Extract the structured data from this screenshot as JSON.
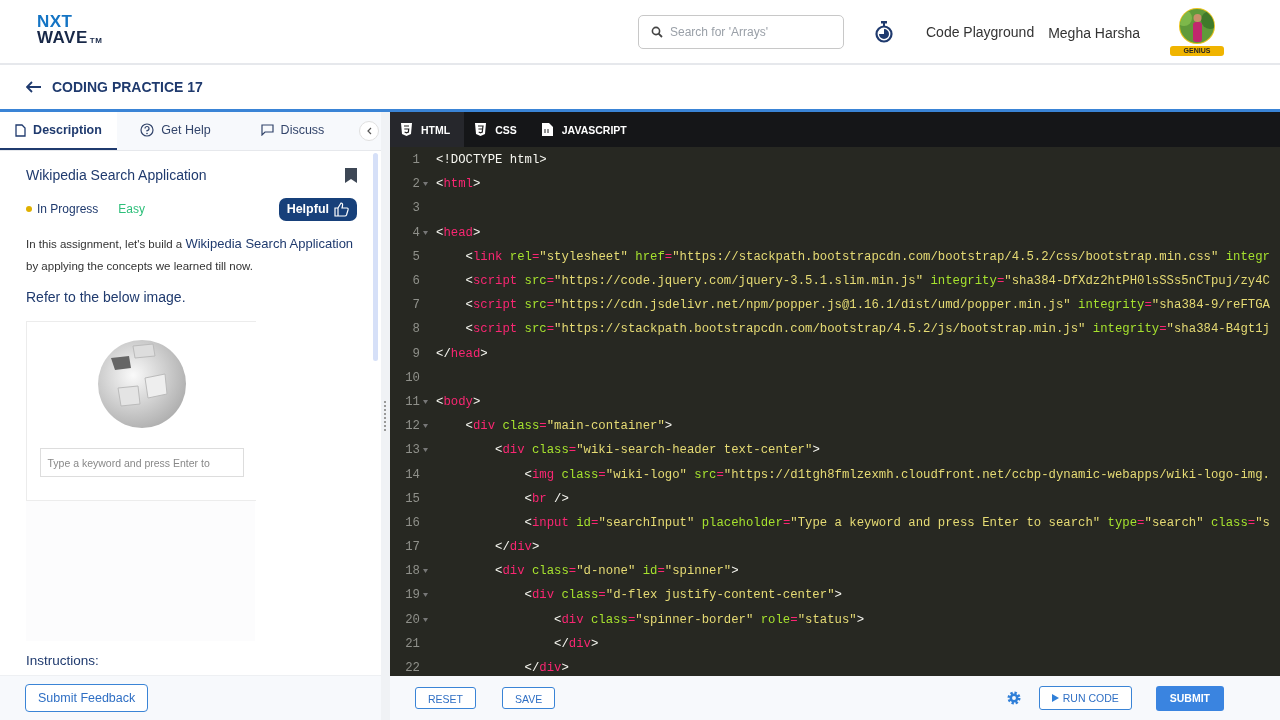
{
  "header": {
    "logo_top": "NXT",
    "logo_bottom": "WAVE",
    "logo_tm": "TM",
    "search": {
      "placeholder": "Search for 'Arrays'"
    },
    "links": [
      "Code Playground"
    ],
    "user": "Megha Harsha",
    "badge": "GENIUS"
  },
  "breadcrumb": {
    "title": "CODING PRACTICE 17"
  },
  "left_tabs": [
    {
      "label": "Description",
      "selected": true
    },
    {
      "label": "Get Help",
      "selected": false
    },
    {
      "label": "Discuss",
      "selected": false
    }
  ],
  "problem": {
    "title": "Wikipedia Search Application",
    "bookmarked": true,
    "status": "In Progress",
    "difficulty": "Easy",
    "helpful": "Helpful",
    "intro": "In this assignment, let's build a **Wikipedia Search Application** by applying the concepts we learned till now.",
    "refer": "Refer to the below image.",
    "preview_placeholder": "Type a keyword and press Enter to",
    "instructions": "Instructions:"
  },
  "submit_feedback": "Submit Feedback",
  "editor_tabs": [
    {
      "label": "HTML",
      "selected": true
    },
    {
      "label": "CSS",
      "selected": false
    },
    {
      "label": "JAVASCRIPT",
      "selected": false
    }
  ],
  "code_lines": [
    {
      "number": "1",
      "foldable": false,
      "tokens": [
        {
          "kind": "text",
          "text": "<!DOCTYPE html>"
        }
      ]
    },
    {
      "number": "2",
      "foldable": true,
      "tokens": [
        {
          "kind": "punct",
          "text": "<"
        },
        {
          "kind": "tag",
          "text": "html"
        },
        {
          "kind": "punct",
          "text": ">"
        }
      ]
    },
    {
      "number": "3",
      "foldable": false
    },
    {
      "number": "4",
      "foldable": true,
      "tokens": [
        {
          "kind": "punct",
          "text": "<"
        },
        {
          "kind": "tag",
          "text": "head"
        },
        {
          "kind": "punct",
          "text": ">"
        }
      ]
    },
    {
      "number": "5",
      "foldable": false,
      "tokens": [
        {
          "kind": "text",
          "text": "    <"
        },
        {
          "kind": "tag",
          "text": "link"
        },
        {
          "kind": "attr",
          "text": " rel"
        },
        {
          "kind": "tag",
          "text": "="
        },
        {
          "kind": "str",
          "text": "\"stylesheet\""
        },
        {
          "kind": "attr",
          "text": " href"
        },
        {
          "kind": "tag",
          "text": "="
        },
        {
          "kind": "str",
          "text": "\"https://stackpath.bootstrapcdn.com/bootstrap/4.5.2/css/bootstrap.min.css\""
        },
        {
          "kind": "attr",
          "text": " integr"
        }
      ]
    },
    {
      "number": "6",
      "foldable": false,
      "tokens": [
        {
          "kind": "text",
          "text": "    <"
        },
        {
          "kind": "tag",
          "text": "script"
        },
        {
          "kind": "attr",
          "text": " src"
        },
        {
          "kind": "tag",
          "text": "="
        },
        {
          "kind": "str",
          "text": "\"https://code.jquery.com/jquery-3.5.1.slim.min.js\""
        },
        {
          "kind": "attr",
          "text": " integrity"
        },
        {
          "kind": "tag",
          "text": "="
        },
        {
          "kind": "str",
          "text": "\"sha384-DfXdz2htPH0lsSSs5nCTpuj/zy4C"
        }
      ]
    },
    {
      "number": "7",
      "foldable": false,
      "tokens": [
        {
          "kind": "text",
          "text": "    <"
        },
        {
          "kind": "tag",
          "text": "script"
        },
        {
          "kind": "attr",
          "text": " src"
        },
        {
          "kind": "tag",
          "text": "="
        },
        {
          "kind": "str",
          "text": "\"https://cdn.jsdelivr.net/npm/popper.js@1.16.1/dist/umd/popper.min.js\""
        },
        {
          "kind": "attr",
          "text": " integrity"
        },
        {
          "kind": "tag",
          "text": "="
        },
        {
          "kind": "str",
          "text": "\"sha384-9/reFTGA"
        }
      ]
    },
    {
      "number": "8",
      "foldable": false,
      "tokens": [
        {
          "kind": "text",
          "text": "    <"
        },
        {
          "kind": "tag",
          "text": "script"
        },
        {
          "kind": "attr",
          "text": " src"
        },
        {
          "kind": "tag",
          "text": "="
        },
        {
          "kind": "str",
          "text": "\"https://stackpath.bootstrapcdn.com/bootstrap/4.5.2/js/bootstrap.min.js\""
        },
        {
          "kind": "attr",
          "text": " integrity"
        },
        {
          "kind": "tag",
          "text": "="
        },
        {
          "kind": "str",
          "text": "\"sha384-B4gt1j"
        }
      ]
    },
    {
      "number": "9",
      "foldable": false,
      "tokens": [
        {
          "kind": "punct",
          "text": "</"
        },
        {
          "kind": "tag",
          "text": "head"
        },
        {
          "kind": "punct",
          "text": ">"
        }
      ]
    },
    {
      "number": "10",
      "foldable": false
    },
    {
      "number": "11",
      "foldable": true,
      "tokens": [
        {
          "kind": "punct",
          "text": "<"
        },
        {
          "kind": "tag",
          "text": "body"
        },
        {
          "kind": "punct",
          "text": ">"
        }
      ]
    },
    {
      "number": "12",
      "foldable": true,
      "tokens": [
        {
          "kind": "text",
          "text": "    <"
        },
        {
          "kind": "tag",
          "text": "div"
        },
        {
          "kind": "attr",
          "text": " class"
        },
        {
          "kind": "tag",
          "text": "="
        },
        {
          "kind": "str",
          "text": "\"main-container\""
        },
        {
          "kind": "punct",
          "text": ">"
        }
      ]
    },
    {
      "number": "13",
      "foldable": true,
      "tokens": [
        {
          "kind": "text",
          "text": "        <"
        },
        {
          "kind": "tag",
          "text": "div"
        },
        {
          "kind": "attr",
          "text": " class"
        },
        {
          "kind": "tag",
          "text": "="
        },
        {
          "kind": "str",
          "text": "\"wiki-search-header text-center\""
        },
        {
          "kind": "punct",
          "text": ">"
        }
      ]
    },
    {
      "number": "14",
      "foldable": false,
      "tokens": [
        {
          "kind": "text",
          "text": "            <"
        },
        {
          "kind": "tag",
          "text": "img"
        },
        {
          "kind": "attr",
          "text": " class"
        },
        {
          "kind": "tag",
          "text": "="
        },
        {
          "kind": "str",
          "text": "\"wiki-logo\""
        },
        {
          "kind": "attr",
          "text": " src"
        },
        {
          "kind": "tag",
          "text": "="
        },
        {
          "kind": "str",
          "text": "\"https://d1tgh8fmlzexmh.cloudfront.net/ccbp-dynamic-webapps/wiki-logo-img."
        }
      ]
    },
    {
      "number": "15",
      "foldable": false,
      "tokens": [
        {
          "kind": "text",
          "text": "            <"
        },
        {
          "kind": "tag",
          "text": "br"
        },
        {
          "kind": "text",
          "text": " />"
        }
      ]
    },
    {
      "number": "16",
      "foldable": false,
      "tokens": [
        {
          "kind": "text",
          "text": "            <"
        },
        {
          "kind": "tag",
          "text": "input"
        },
        {
          "kind": "attr",
          "text": " id"
        },
        {
          "kind": "tag",
          "text": "="
        },
        {
          "kind": "str",
          "text": "\"searchInput\""
        },
        {
          "kind": "attr",
          "text": " placeholder"
        },
        {
          "kind": "tag",
          "text": "="
        },
        {
          "kind": "str",
          "text": "\"Type a keyword and press Enter to search\""
        },
        {
          "kind": "attr",
          "text": " type"
        },
        {
          "kind": "tag",
          "text": "="
        },
        {
          "kind": "str",
          "text": "\"search\""
        },
        {
          "kind": "attr",
          "text": " class"
        },
        {
          "kind": "tag",
          "text": "="
        },
        {
          "kind": "str",
          "text": "\"s"
        }
      ]
    },
    {
      "number": "17",
      "foldable": false,
      "tokens": [
        {
          "kind": "text",
          "text": "        </"
        },
        {
          "kind": "tag",
          "text": "div"
        },
        {
          "kind": "punct",
          "text": ">"
        }
      ]
    },
    {
      "number": "18",
      "foldable": true,
      "tokens": [
        {
          "kind": "text",
          "text": "        <"
        },
        {
          "kind": "tag",
          "text": "div"
        },
        {
          "kind": "attr",
          "text": " class"
        },
        {
          "kind": "tag",
          "text": "="
        },
        {
          "kind": "str",
          "text": "\"d-none\""
        },
        {
          "kind": "attr",
          "text": " id"
        },
        {
          "kind": "tag",
          "text": "="
        },
        {
          "kind": "str",
          "text": "\"spinner\""
        },
        {
          "kind": "punct",
          "text": ">"
        }
      ]
    },
    {
      "number": "19",
      "foldable": true,
      "tokens": [
        {
          "kind": "text",
          "text": "            <"
        },
        {
          "kind": "tag",
          "text": "div"
        },
        {
          "kind": "attr",
          "text": " class"
        },
        {
          "kind": "tag",
          "text": "="
        },
        {
          "kind": "str",
          "text": "\"d-flex justify-content-center\""
        },
        {
          "kind": "punct",
          "text": ">"
        }
      ]
    },
    {
      "number": "20",
      "foldable": true,
      "tokens": [
        {
          "kind": "text",
          "text": "                <"
        },
        {
          "kind": "tag",
          "text": "div"
        },
        {
          "kind": "attr",
          "text": " class"
        },
        {
          "kind": "tag",
          "text": "="
        },
        {
          "kind": "str",
          "text": "\"spinner-border\""
        },
        {
          "kind": "attr",
          "text": " role"
        },
        {
          "kind": "tag",
          "text": "="
        },
        {
          "kind": "str",
          "text": "\"status\""
        },
        {
          "kind": "punct",
          "text": ">"
        }
      ]
    },
    {
      "number": "21",
      "foldable": false,
      "tokens": [
        {
          "kind": "text",
          "text": "                </"
        },
        {
          "kind": "tag",
          "text": "div"
        },
        {
          "kind": "punct",
          "text": ">"
        }
      ]
    },
    {
      "number": "22",
      "foldable": false,
      "tokens": [
        {
          "kind": "text",
          "text": "            </"
        },
        {
          "kind": "tag",
          "text": "div"
        },
        {
          "kind": "punct",
          "text": ">"
        }
      ]
    }
  ],
  "editor_buttons": {
    "reset": "RESET",
    "save": "SAVE",
    "run": "RUN CODE",
    "submit": "SUBMIT"
  }
}
